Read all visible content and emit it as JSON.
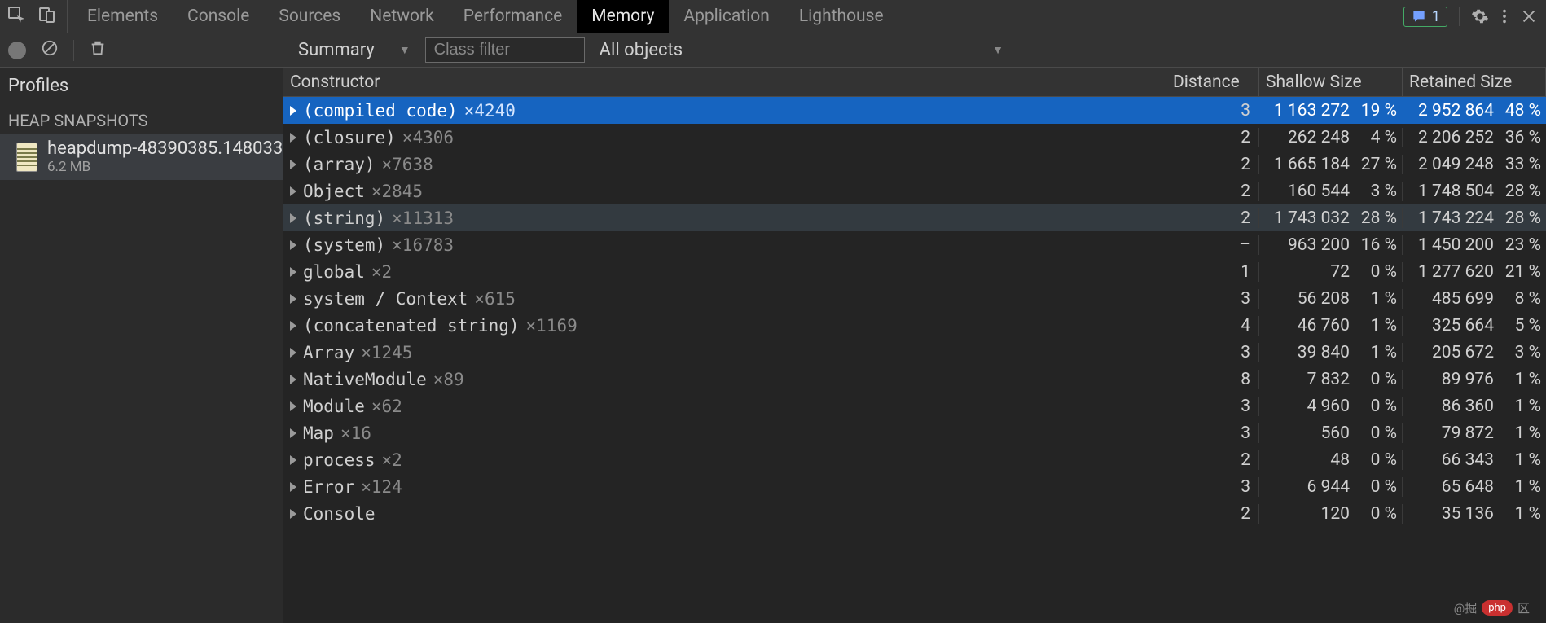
{
  "tabs": {
    "items": [
      "Elements",
      "Console",
      "Sources",
      "Network",
      "Performance",
      "Memory",
      "Application",
      "Lighthouse"
    ],
    "active": "Memory"
  },
  "issues": {
    "count": "1"
  },
  "toolbar": {
    "summary_label": "Summary",
    "class_filter_placeholder": "Class filter",
    "all_objects_label": "All objects"
  },
  "sidebar": {
    "profiles_label": "Profiles",
    "section_label": "HEAP SNAPSHOTS",
    "snapshots": [
      {
        "name": "heapdump-48390385.148033",
        "size": "6.2 MB"
      }
    ]
  },
  "table": {
    "columns": {
      "constructor": "Constructor",
      "distance": "Distance",
      "shallow": "Shallow Size",
      "retained": "Retained Size"
    },
    "rows": [
      {
        "name": "(compiled code)",
        "count": "×4240",
        "distance": "3",
        "shallow": "1 163 272",
        "shallow_pct": "19 %",
        "retained": "2 952 864",
        "retained_pct": "48 %",
        "selected": true
      },
      {
        "name": "(closure)",
        "count": "×4306",
        "distance": "2",
        "shallow": "262 248",
        "shallow_pct": "4 %",
        "retained": "2 206 252",
        "retained_pct": "36 %"
      },
      {
        "name": "(array)",
        "count": "×7638",
        "distance": "2",
        "shallow": "1 665 184",
        "shallow_pct": "27 %",
        "retained": "2 049 248",
        "retained_pct": "33 %"
      },
      {
        "name": "Object",
        "count": "×2845",
        "distance": "2",
        "shallow": "160 544",
        "shallow_pct": "3 %",
        "retained": "1 748 504",
        "retained_pct": "28 %"
      },
      {
        "name": "(string)",
        "count": "×11313",
        "distance": "2",
        "shallow": "1 743 032",
        "shallow_pct": "28 %",
        "retained": "1 743 224",
        "retained_pct": "28 %",
        "hover": true
      },
      {
        "name": "(system)",
        "count": "×16783",
        "distance": "–",
        "shallow": "963 200",
        "shallow_pct": "16 %",
        "retained": "1 450 200",
        "retained_pct": "23 %"
      },
      {
        "name": "global",
        "count": "×2",
        "distance": "1",
        "shallow": "72",
        "shallow_pct": "0 %",
        "retained": "1 277 620",
        "retained_pct": "21 %"
      },
      {
        "name": "system / Context",
        "count": "×615",
        "distance": "3",
        "shallow": "56 208",
        "shallow_pct": "1 %",
        "retained": "485 699",
        "retained_pct": "8 %"
      },
      {
        "name": "(concatenated string)",
        "count": "×1169",
        "distance": "4",
        "shallow": "46 760",
        "shallow_pct": "1 %",
        "retained": "325 664",
        "retained_pct": "5 %"
      },
      {
        "name": "Array",
        "count": "×1245",
        "distance": "3",
        "shallow": "39 840",
        "shallow_pct": "1 %",
        "retained": "205 672",
        "retained_pct": "3 %"
      },
      {
        "name": "NativeModule",
        "count": "×89",
        "distance": "8",
        "shallow": "7 832",
        "shallow_pct": "0 %",
        "retained": "89 976",
        "retained_pct": "1 %"
      },
      {
        "name": "Module",
        "count": "×62",
        "distance": "3",
        "shallow": "4 960",
        "shallow_pct": "0 %",
        "retained": "86 360",
        "retained_pct": "1 %"
      },
      {
        "name": "Map",
        "count": "×16",
        "distance": "3",
        "shallow": "560",
        "shallow_pct": "0 %",
        "retained": "79 872",
        "retained_pct": "1 %"
      },
      {
        "name": "process",
        "count": "×2",
        "distance": "2",
        "shallow": "48",
        "shallow_pct": "0 %",
        "retained": "66 343",
        "retained_pct": "1 %"
      },
      {
        "name": "Error",
        "count": "×124",
        "distance": "3",
        "shallow": "6 944",
        "shallow_pct": "0 %",
        "retained": "65 648",
        "retained_pct": "1 %"
      },
      {
        "name": "Console",
        "count": "",
        "distance": "2",
        "shallow": "120",
        "shallow_pct": "0 %",
        "retained": "35 136",
        "retained_pct": "1 %"
      }
    ]
  },
  "watermark": {
    "text": "@掘",
    "pill": "php",
    "tail": "区"
  }
}
